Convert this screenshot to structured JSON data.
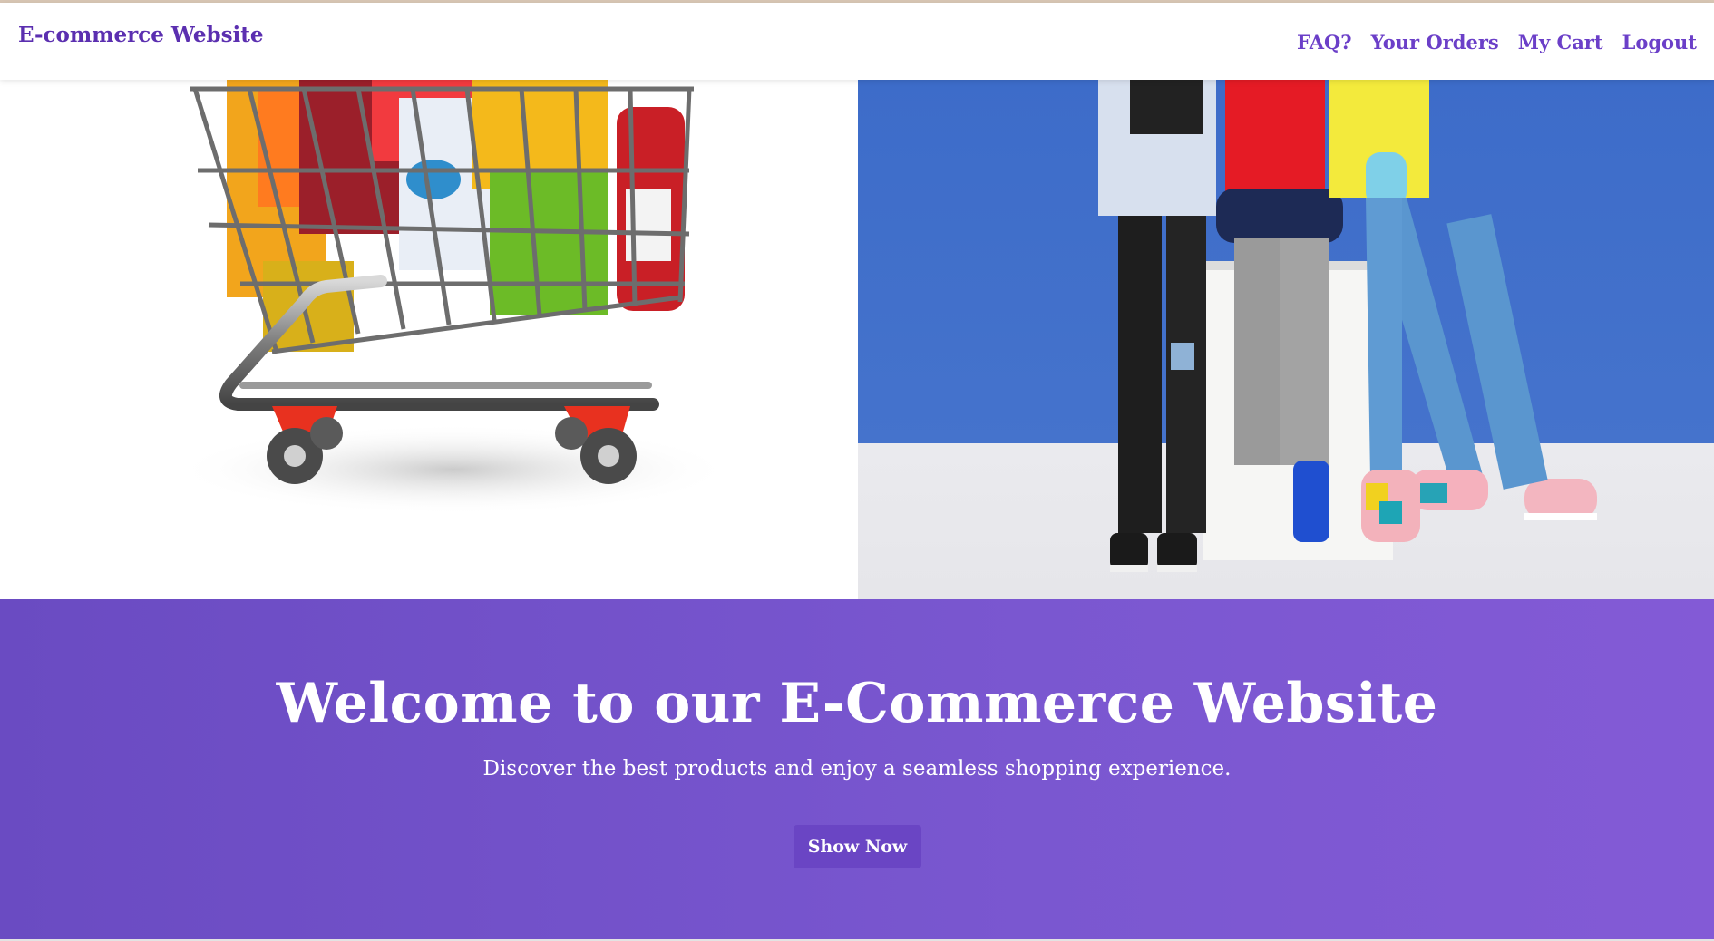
{
  "navbar": {
    "brand": "E-commerce Website",
    "links": [
      {
        "label": "FAQ?"
      },
      {
        "label": "Your Orders"
      },
      {
        "label": "My Cart"
      },
      {
        "label": "Logout"
      }
    ]
  },
  "banner": {
    "left_image_icon": "shopping-cart-image",
    "right_image_icon": "fashion-people-image"
  },
  "hero": {
    "title": "Welcome to our E-Commerce Website",
    "subtitle": "Discover the best products and enjoy a seamless shopping experience.",
    "cta_label": "Show Now"
  },
  "colors": {
    "brand": "#5b2fb0",
    "nav_link": "#6b3fc8",
    "hero_bg": "#7552cc",
    "button_bg": "#6a45c4"
  }
}
